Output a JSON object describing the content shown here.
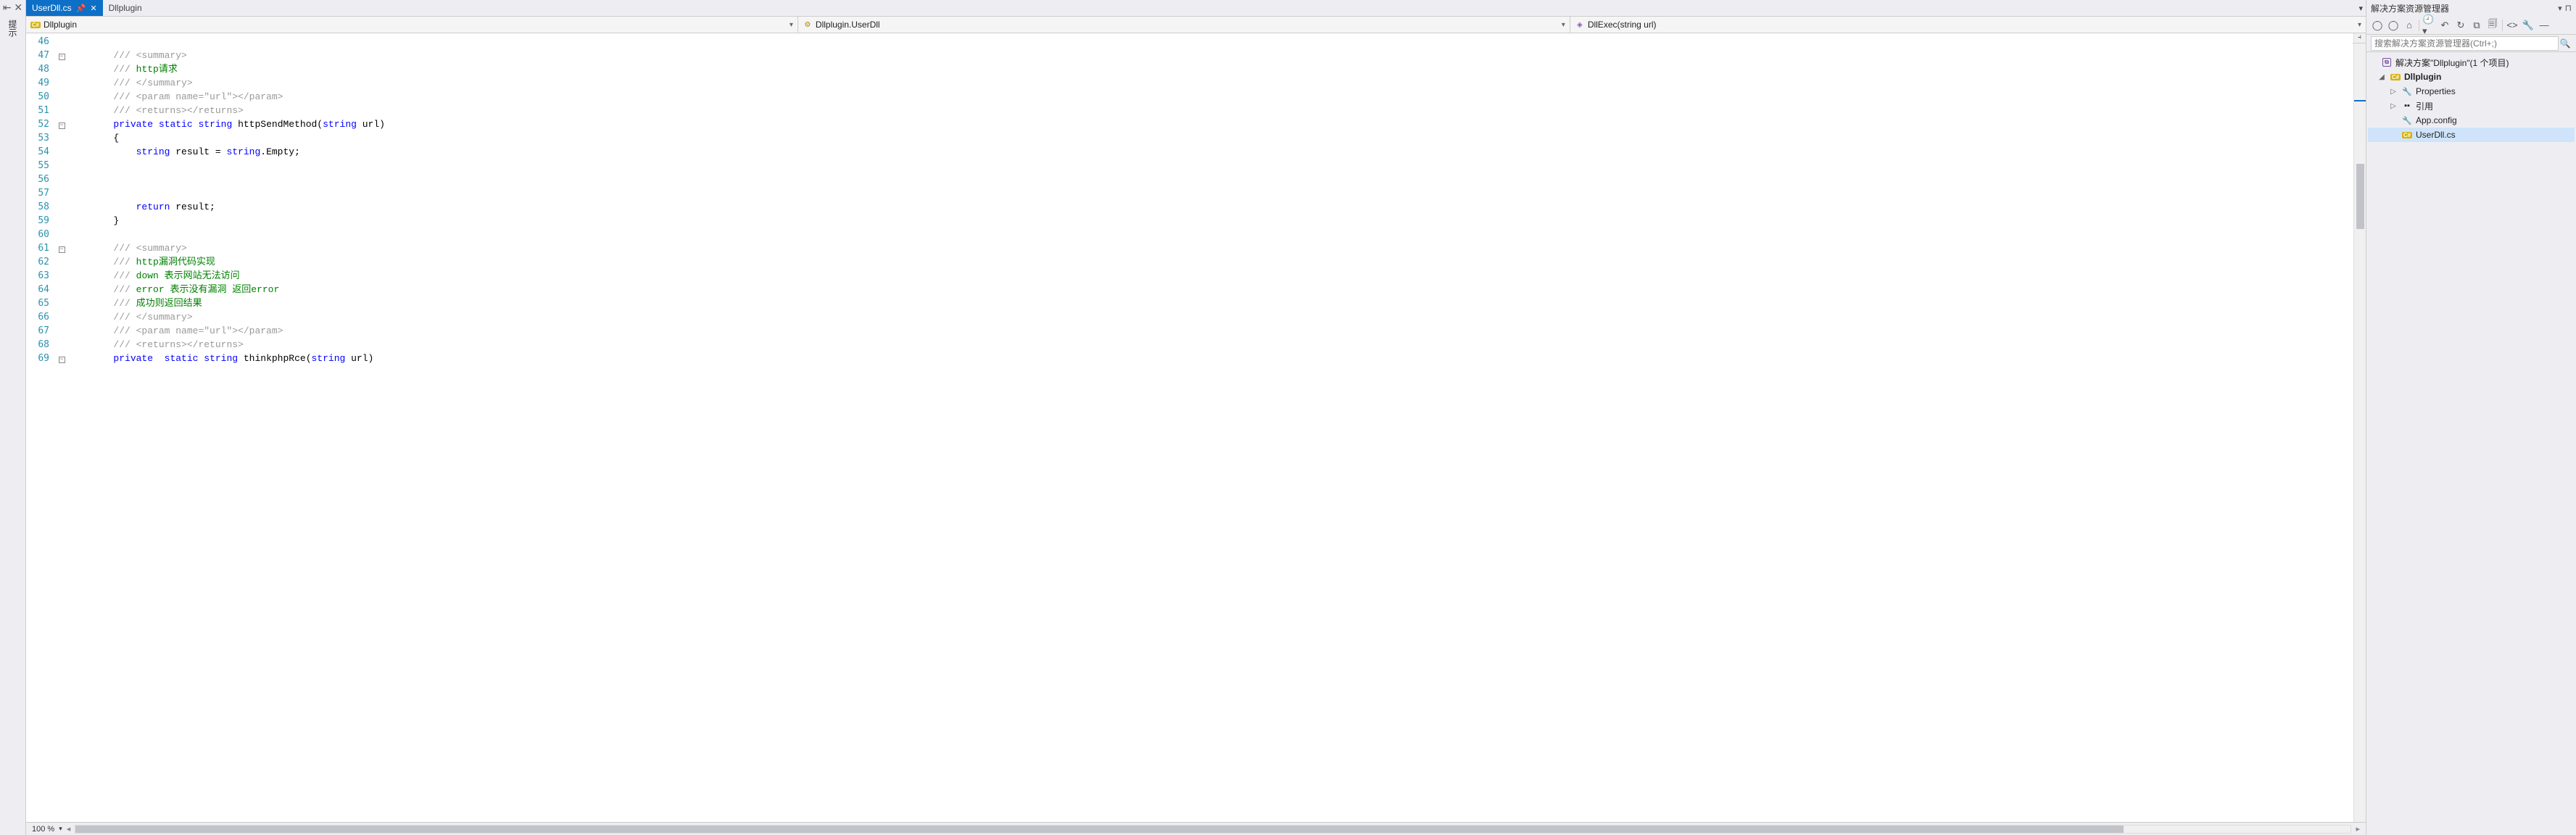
{
  "left_panel_label": "提示",
  "tabs": {
    "active": "UserDll.cs",
    "inactive": "Dllplugin"
  },
  "nav": {
    "scope": "Dllplugin",
    "class": "Dllplugin.UserDll",
    "method": "DllExec(string url)"
  },
  "lines": [
    {
      "n": 46,
      "fold": "",
      "html": ""
    },
    {
      "n": 47,
      "fold": "box",
      "html": "        <span class='cm'>/// &lt;summary&gt;</span>"
    },
    {
      "n": 48,
      "fold": "",
      "html": "        <span class='cm'>///</span> <span class='cg'>http请求</span>"
    },
    {
      "n": 49,
      "fold": "",
      "html": "        <span class='cm'>/// &lt;/summary&gt;</span>"
    },
    {
      "n": 50,
      "fold": "",
      "html": "        <span class='cm'>/// &lt;param name=\"url\"&gt;&lt;/param&gt;</span>"
    },
    {
      "n": 51,
      "fold": "",
      "html": "        <span class='cm'>/// &lt;returns&gt;&lt;/returns&gt;</span>"
    },
    {
      "n": 52,
      "fold": "box",
      "html": "        <span class='kw'>private</span> <span class='kw'>static</span> <span class='kw'>string</span> httpSendMethod(<span class='kw'>string</span> url)"
    },
    {
      "n": 53,
      "fold": "",
      "html": "        {"
    },
    {
      "n": 54,
      "fold": "",
      "html": "            <span class='kw'>string</span> result = <span class='kw'>string</span>.Empty;"
    },
    {
      "n": 55,
      "fold": "",
      "html": ""
    },
    {
      "n": 56,
      "fold": "",
      "html": ""
    },
    {
      "n": 57,
      "fold": "",
      "html": ""
    },
    {
      "n": 58,
      "fold": "",
      "html": "            <span class='kw'>return</span> result;"
    },
    {
      "n": 59,
      "fold": "",
      "html": "        }"
    },
    {
      "n": 60,
      "fold": "",
      "html": ""
    },
    {
      "n": 61,
      "fold": "box",
      "html": "        <span class='cm'>/// &lt;summary&gt;</span>"
    },
    {
      "n": 62,
      "fold": "",
      "html": "        <span class='cm'>///</span> <span class='cg'>http漏洞代码实现</span>"
    },
    {
      "n": 63,
      "fold": "",
      "html": "        <span class='cm'>///</span> <span class='cg'>down 表示网站无法访问</span>"
    },
    {
      "n": 64,
      "fold": "",
      "html": "        <span class='cm'>///</span> <span class='cg'>error 表示没有漏洞 返回error</span>"
    },
    {
      "n": 65,
      "fold": "",
      "html": "        <span class='cm'>///</span> <span class='cg'>成功则返回结果</span>"
    },
    {
      "n": 66,
      "fold": "",
      "html": "        <span class='cm'>/// &lt;/summary&gt;</span>"
    },
    {
      "n": 67,
      "fold": "",
      "html": "        <span class='cm'>/// &lt;param name=\"url\"&gt;&lt;/param&gt;</span>"
    },
    {
      "n": 68,
      "fold": "",
      "html": "        <span class='cm'>/// &lt;returns&gt;&lt;/returns&gt;</span>"
    },
    {
      "n": 69,
      "fold": "box",
      "html": "        <span class='kw'>private</span>  <span class='kw'>static</span> <span class='kw'>string</span> thinkphpRce(<span class='kw'>string</span> url)"
    }
  ],
  "status": {
    "zoom": "100 %"
  },
  "solution_explorer": {
    "title": "解决方案资源管理器",
    "search_placeholder": "搜索解决方案资源管理器(Ctrl+;)",
    "solution_label": "解决方案\"Dllplugin\"(1 个项目)",
    "project": "Dllplugin",
    "nodes": {
      "properties": "Properties",
      "references": "引用",
      "appconfig": "App.config",
      "userdll": "UserDll.cs"
    }
  }
}
